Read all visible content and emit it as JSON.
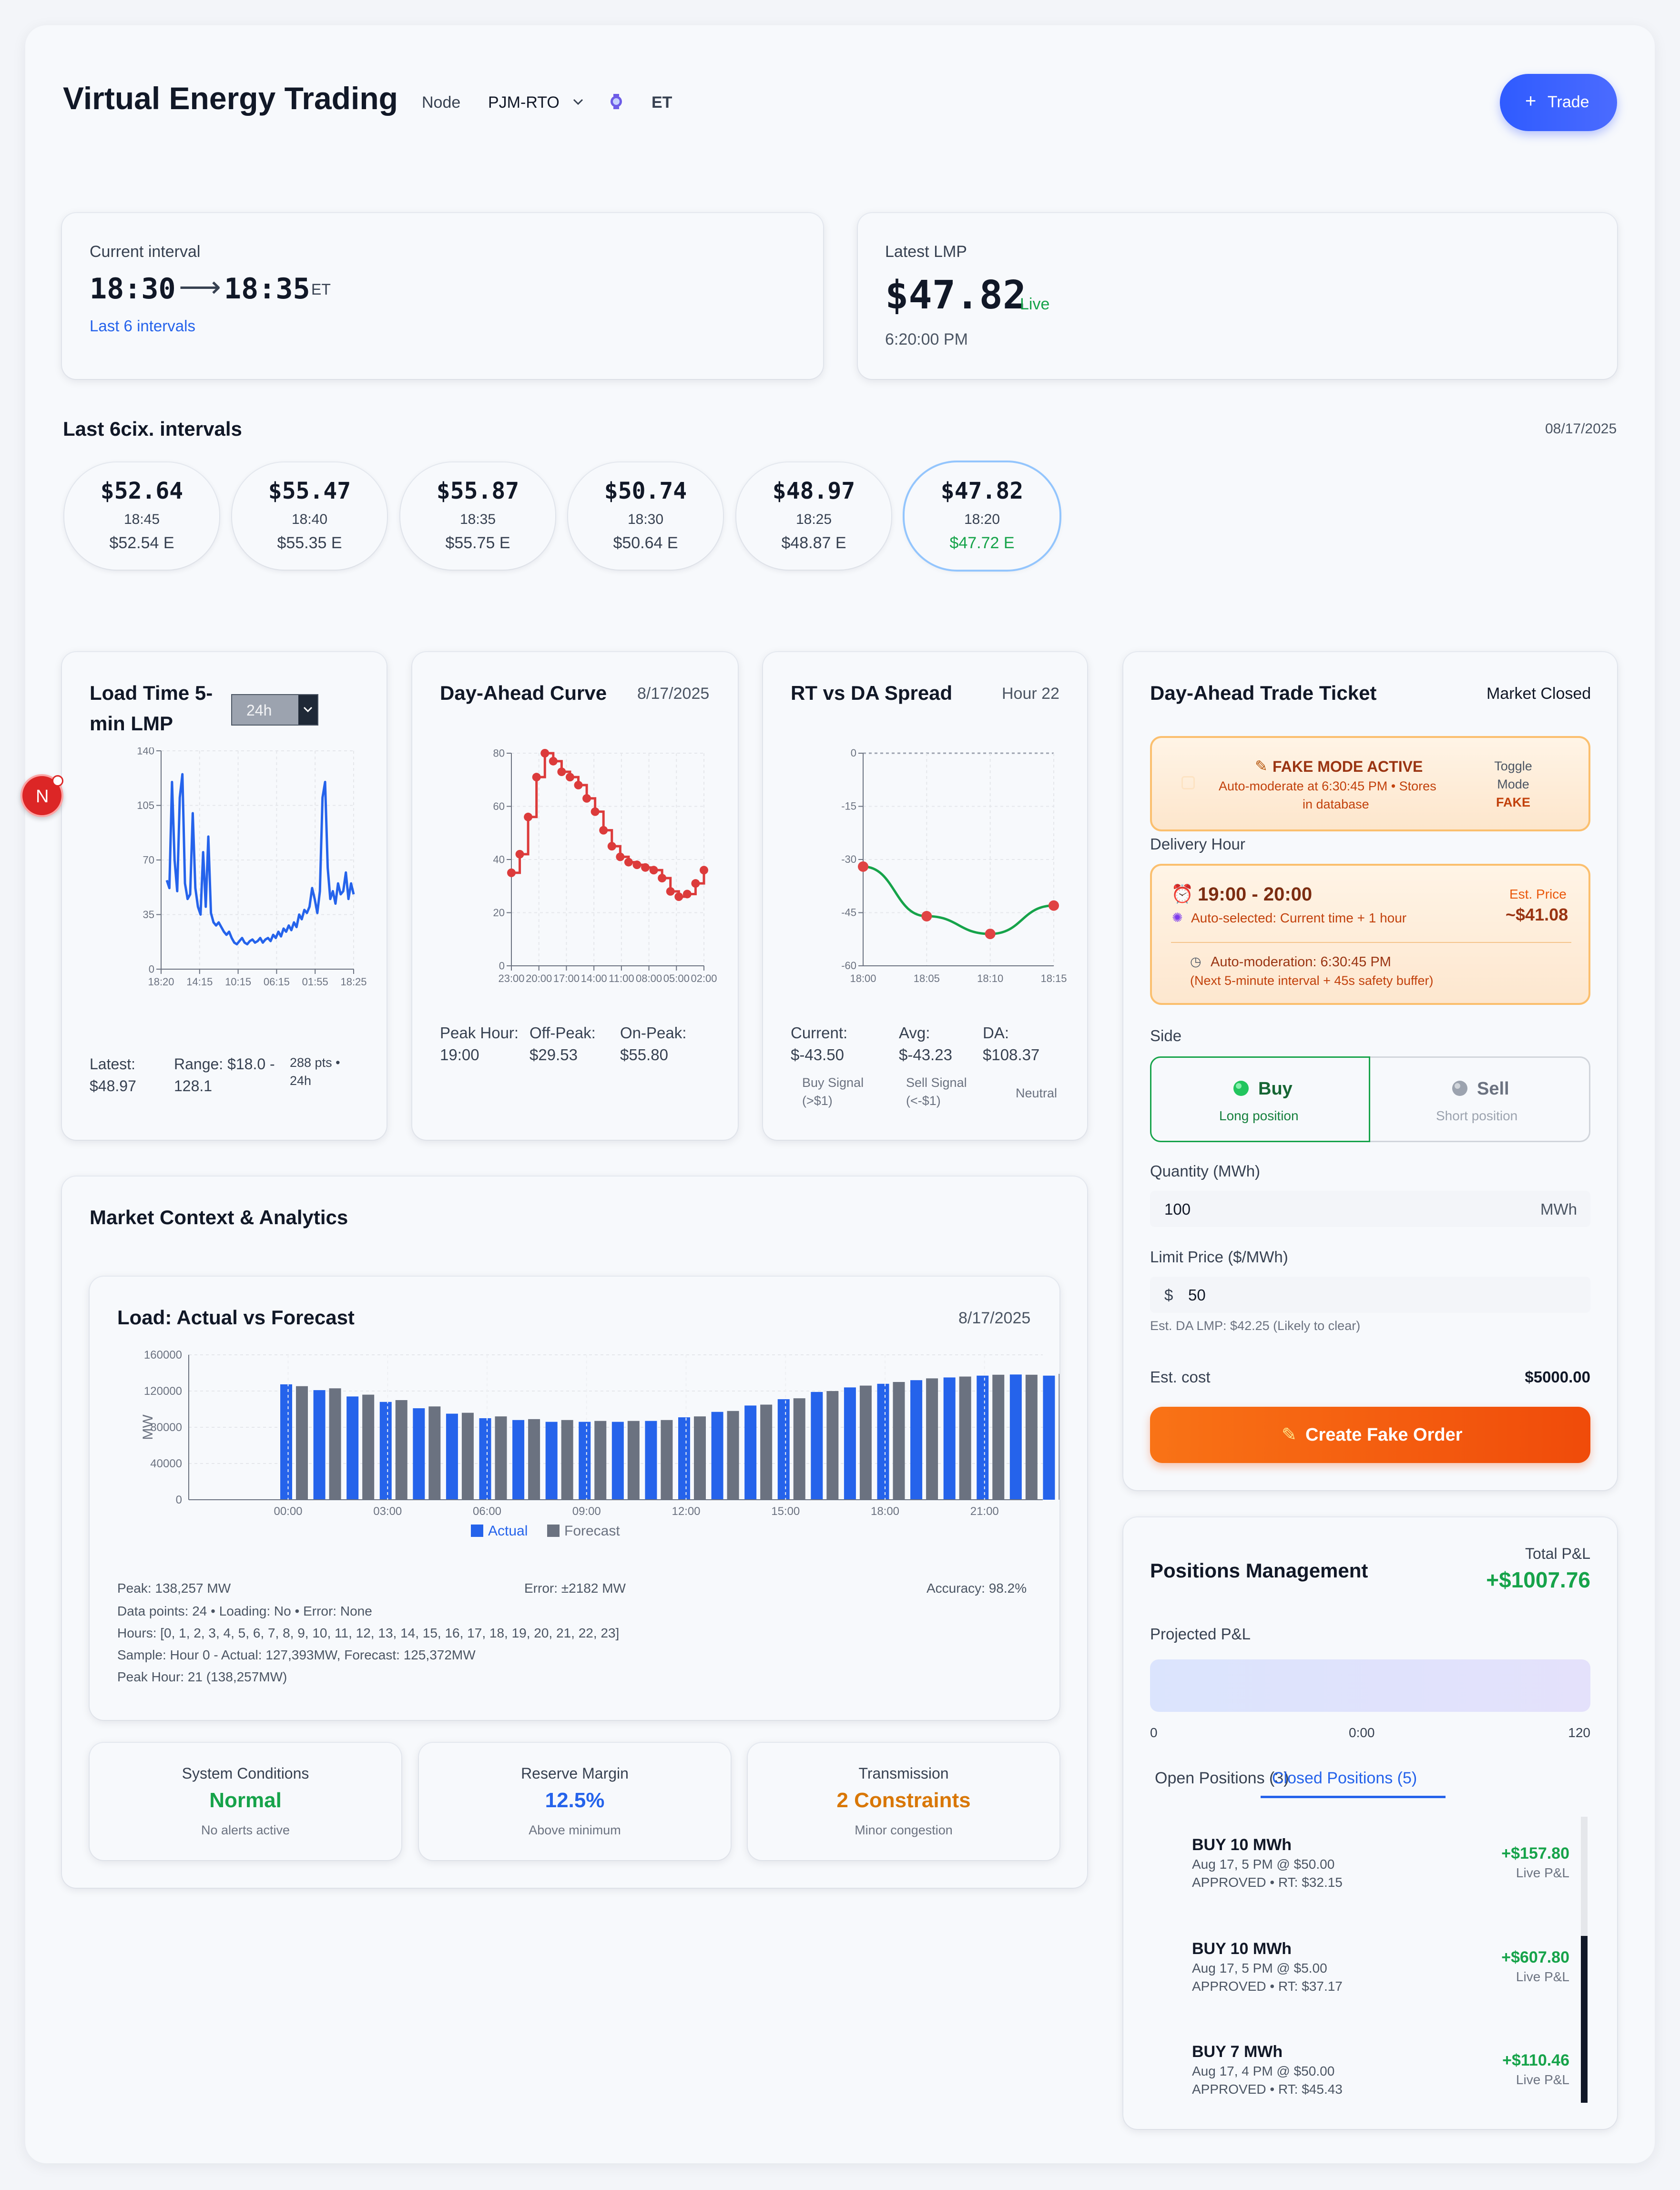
{
  "header": {
    "title": "Virtual Energy Trading",
    "node_label": "Node",
    "node_value": "PJM-RTO",
    "timezone": "ET",
    "trade_button": "Trade"
  },
  "current_interval": {
    "label": "Current interval",
    "start": "18:30",
    "end": "18:35",
    "tz": "ET",
    "link": "Last 6 intervals"
  },
  "latest_lmp": {
    "label": "Latest LMP",
    "value": "$47.82",
    "status": "Live",
    "time": "6:20:00 PM"
  },
  "intervals": {
    "title": "Last 6cix. intervals",
    "date": "08/17/2025",
    "items": [
      {
        "price": "$52.64",
        "time": "18:45",
        "est": "$52.54 E"
      },
      {
        "price": "$55.47",
        "time": "18:40",
        "est": "$55.35 E"
      },
      {
        "price": "$55.87",
        "time": "18:35",
        "est": "$55.75 E"
      },
      {
        "price": "$50.74",
        "time": "18:30",
        "est": "$50.64 E"
      },
      {
        "price": "$48.97",
        "time": "18:25",
        "est": "$48.87 E"
      },
      {
        "price": "$47.82",
        "time": "18:20",
        "est": "$47.72 E"
      }
    ]
  },
  "load_time_card": {
    "title_line1": "Load Time 5-",
    "title_line2": "min LMP",
    "range_select": "24h",
    "latest_label": "Latest:",
    "latest_value": "$48.97",
    "range_label": "Range: $18.0 -",
    "range_value": "128.1",
    "pts_line1": "288 pts •",
    "pts_line2": "24h"
  },
  "day_ahead_card": {
    "title": "Day-Ahead Curve",
    "date": "8/17/2025",
    "peak_label": "Peak Hour:",
    "peak_value": "19:00",
    "offpeak_label": "Off-Peak:",
    "offpeak_value": "$29.53",
    "onpeak_label": "On-Peak:",
    "onpeak_value": "$55.80"
  },
  "spread_card": {
    "title": "RT vs DA Spread",
    "hour": "Hour 22",
    "current_label": "Current:",
    "current_value": "$-43.50",
    "avg_label": "Avg:",
    "avg_value": "$-43.23",
    "da_label": "DA:",
    "da_value": "$108.37",
    "buy_signal_1": "Buy Signal",
    "buy_signal_2": "(>$1)",
    "sell_signal_1": "Sell Signal",
    "sell_signal_2": "(<-$1)",
    "neutral": "Neutral"
  },
  "trade_ticket": {
    "title": "Day-Ahead Trade Ticket",
    "market_status": "Market Closed",
    "fake_mode_title": "FAKE MODE ACTIVE",
    "fake_mode_line1": "Auto-moderate at 6:30:45 PM • Stores",
    "fake_mode_line2": "in database",
    "toggle_label_1": "Toggle",
    "toggle_label_2": "Mode",
    "toggle_value": "FAKE",
    "delivery_label": "Delivery Hour",
    "delivery_value": "19:00 - 20:00",
    "auto_selected": "Auto-selected: Current time + 1 hour",
    "est_price_label": "Est. Price",
    "est_price_value": "~$41.08",
    "moderation_line1": "Auto-moderation: 6:30:45 PM",
    "moderation_line2": "(Next 5-minute interval + 45s safety buffer)",
    "side_label": "Side",
    "buy_label": "Buy",
    "buy_sub": "Long position",
    "sell_label": "Sell",
    "sell_sub": "Short position",
    "quantity_label": "Quantity (MWh)",
    "quantity_value": "100",
    "quantity_unit": "MWh",
    "limit_label": "Limit Price ($/MWh)",
    "limit_currency": "$",
    "limit_value": "50",
    "est_da_note": "Est. DA LMP: $42.25 (Likely to clear)",
    "est_cost_label": "Est. cost",
    "est_cost_value": "$5000.00",
    "submit_button": "Create Fake Order"
  },
  "market_context": {
    "title": "Market Context & Analytics",
    "chart_title": "Load: Actual vs Forecast",
    "chart_date": "8/17/2025",
    "peak_text": "Peak: 138,257 MW",
    "error_text": "Error: ±2182 MW",
    "accuracy_text": "Accuracy: 98.2%",
    "debug_1": "Data points: 24 • Loading: No • Error: None",
    "debug_2": "Hours: [0, 1, 2, 3, 4, 5, 6, 7, 8, 9, 10, 11, 12, 13, 14, 15, 16, 17, 18, 19, 20, 21, 22, 23]",
    "debug_3": "Sample: Hour 0 - Actual: 127,393MW, Forecast: 125,372MW",
    "debug_4": "Peak Hour: 21 (138,257MW)",
    "system_label": "System Conditions",
    "system_value": "Normal",
    "system_sub": "No alerts active",
    "reserve_label": "Reserve Margin",
    "reserve_value": "12.5%",
    "reserve_sub": "Above minimum",
    "transmission_label": "Transmission",
    "transmission_value": "2 Constraints",
    "transmission_sub": "Minor congestion"
  },
  "positions": {
    "title": "Positions Management",
    "total_label": "Total P&L",
    "total_value": "+$1007.76",
    "projected_label": "Projected P&L",
    "axis_left": "0",
    "axis_mid": "0:00",
    "axis_right": "120",
    "tab_open": "Open Positions (3)",
    "tab_closed": "Closed Positions (5)",
    "items": [
      {
        "title": "BUY 10 MWh",
        "detail": "Aug 17, 5 PM @ $50.00",
        "status": "APPROVED • RT: $32.15",
        "pnl": "+$157.80",
        "pnl_label": "Live P&L"
      },
      {
        "title": "BUY 10 MWh",
        "detail": "Aug 17, 5 PM @ $5.00",
        "status": "APPROVED • RT: $37.17",
        "pnl": "+$607.80",
        "pnl_label": "Live P&L"
      },
      {
        "title": "BUY 7 MWh",
        "detail": "Aug 17, 4 PM @ $50.00",
        "status": "APPROVED • RT: $45.43",
        "pnl": "+$110.46",
        "pnl_label": "Live P&L"
      }
    ]
  },
  "avatar_letter": "N",
  "colors": {
    "accent_blue": "#2563eb",
    "trade_button": "#3b5bff",
    "order_button": "#f25c0b",
    "positive": "#16a34a",
    "warning_orange": "#d97706",
    "line_red": "#dc3b3b",
    "spread_green": "#16a34a"
  },
  "chart_data": [
    {
      "type": "line",
      "title": "Load Time 5-min LMP",
      "x_tick_labels": [
        "18:20",
        "14:15",
        "10:15",
        "06:15",
        "01:55",
        "18:25"
      ],
      "y_ticks": [
        0,
        35,
        70,
        105,
        140
      ],
      "ylim": [
        0,
        140
      ],
      "grid": true,
      "series": [
        {
          "values": [
            57,
            52,
            120,
            70,
            50,
            110,
            125,
            55,
            45,
            48,
            100,
            52,
            40,
            35,
            75,
            40,
            85,
            36,
            30,
            28,
            30,
            27,
            24,
            22,
            24,
            20,
            17,
            16,
            18,
            20,
            17,
            16,
            18,
            19,
            17,
            18,
            20,
            17,
            19,
            20,
            18,
            22,
            20,
            24,
            21,
            26,
            24,
            28,
            25,
            30,
            27,
            35,
            32,
            38,
            36,
            40,
            52,
            45,
            36,
            50,
            110,
            120,
            65,
            45,
            50,
            42,
            55,
            48,
            50,
            62,
            45,
            55,
            48
          ]
        }
      ]
    },
    {
      "type": "line",
      "title": "Day-Ahead Curve",
      "x_tick_labels": [
        "23:00",
        "20:00",
        "17:00",
        "14:00",
        "11:00",
        "08:00",
        "05:00",
        "02:00"
      ],
      "y_ticks": [
        0,
        20,
        40,
        60,
        80
      ],
      "ylim": [
        0,
        80
      ],
      "grid": true,
      "series": [
        {
          "values": [
            35,
            42,
            56,
            71,
            80,
            77,
            73,
            71,
            68,
            63,
            58,
            51,
            45,
            41,
            39,
            38,
            37,
            36,
            33,
            28,
            26,
            27,
            31,
            36
          ]
        }
      ]
    },
    {
      "type": "line",
      "title": "RT vs DA Spread",
      "x_tick_labels": [
        "18:00",
        "18:05",
        "18:10",
        "18:15"
      ],
      "y_ticks": [
        0,
        -15,
        -30,
        -45,
        -60
      ],
      "ylim": [
        -60,
        0
      ],
      "grid": true,
      "series": [
        {
          "values": [
            -32,
            -46,
            -51,
            -43
          ]
        }
      ]
    },
    {
      "type": "bar",
      "title": "Load: Actual vs Forecast",
      "x_tick_labels": [
        "00:00",
        "03:00",
        "06:00",
        "09:00",
        "12:00",
        "15:00",
        "18:00",
        "21:00"
      ],
      "ylabel": "MW",
      "y_ticks": [
        0,
        40000,
        80000,
        120000,
        160000
      ],
      "ylim": [
        0,
        160000
      ],
      "legend": "bottom",
      "categories": [
        "0",
        "1",
        "2",
        "3",
        "4",
        "5",
        "6",
        "7",
        "8",
        "9",
        "10",
        "11",
        "12",
        "13",
        "14",
        "15",
        "16",
        "17",
        "18",
        "19",
        "20",
        "21",
        "22",
        "23"
      ],
      "series": [
        {
          "name": "Actual",
          "values": [
            127393,
            121000,
            114000,
            108000,
            101000,
            95000,
            90000,
            88000,
            86000,
            86000,
            86000,
            87000,
            91000,
            97000,
            104000,
            111000,
            119000,
            124000,
            128000,
            132000,
            135000,
            137000,
            138257,
            137000
          ]
        },
        {
          "name": "Forecast",
          "values": [
            125372,
            123000,
            116000,
            110000,
            103000,
            96000,
            92000,
            89000,
            88000,
            87000,
            87000,
            88000,
            92000,
            98000,
            105000,
            112000,
            120000,
            126000,
            130000,
            134000,
            136000,
            138000,
            138000,
            139000
          ]
        }
      ]
    }
  ]
}
